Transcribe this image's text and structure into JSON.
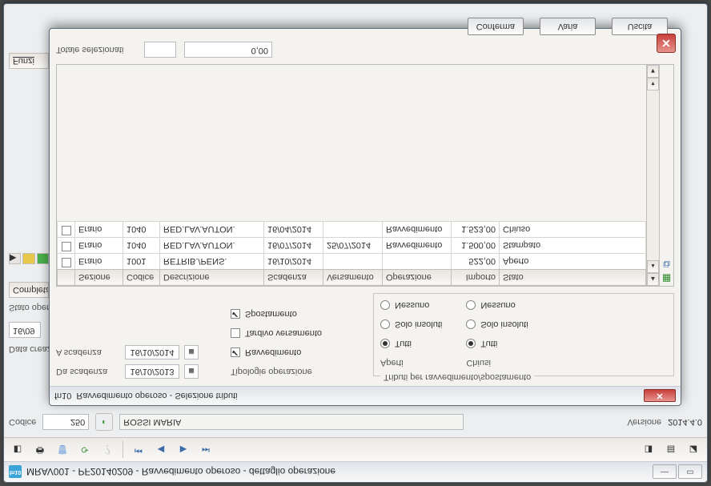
{
  "main_window": {
    "icon_text": "fn10",
    "title": "MRAV001 - PF20140209 - Ravvedimento operoso - dettaglio operazione",
    "codice_label": "Codice",
    "codice_value": "250",
    "codice_name": "ROSSI MARIA",
    "version_label": "Versione",
    "version_value": "2014.4.0",
    "datacrea_label": "Data creazione",
    "datacrea_value": "16/09",
    "stato_label": "Stato operazione",
    "tab_completate": "Completate",
    "menu_funzi": "Funzi"
  },
  "dialog": {
    "icon_text": "fn10",
    "title": "Ravvedimento operoso - Selezione tributi",
    "da_scadenza": "Da scadenza",
    "a_scadenza": "A scadenza",
    "da_val": "16/10/2013",
    "a_val": "16/10/2014",
    "tipologie_label": "Tipologie operazione",
    "ravvedimento": "Ravvedimento",
    "tardivo": "Tardivo versamento",
    "spostamento": "Spostamento",
    "tributi_group": "Tributi per ravvedimento/spostamento",
    "aperti_label": "Aperti",
    "chiusi_label": "Chiusi",
    "tutti": "Tutti",
    "solo_insoluti": "Solo insoluti",
    "nessuno": "Nessuno",
    "columns": {
      "sel": " ",
      "sezione": "Sezione",
      "codice": "Codice",
      "descrizione": "Descrizione",
      "scadenza": "Scadenza",
      "versamento": "Versamento",
      "operazione": "Operazione",
      "importo": "Importo",
      "stato": "Stato"
    },
    "rows": [
      {
        "sez": "Erario",
        "cod": "1001",
        "desc": "RETRIB./PENS.",
        "scad": "16/10/2014",
        "vers": "",
        "op": "",
        "imp": "522,00",
        "stato": "Aperto"
      },
      {
        "sez": "Erario",
        "cod": "1040",
        "desc": "RED.LAV.AUTON.",
        "scad": "16/07/2014",
        "vers": "25/07/2014",
        "op": "Ravvedimento",
        "imp": "1.500,00",
        "stato": "Stampato"
      },
      {
        "sez": "Erario",
        "cod": "1040",
        "desc": "RED.LAV.AUTON.",
        "scad": "16/04/2014",
        "vers": "",
        "op": "Ravvedimento",
        "imp": "1.523,00",
        "stato": "Chiuso"
      }
    ],
    "totale_label": "Totale selezionati",
    "totale_count": "",
    "totale_amount": "0,00",
    "btn_conferma": "Conferma",
    "btn_varia": "Varia",
    "btn_uscita": "Uscita"
  }
}
